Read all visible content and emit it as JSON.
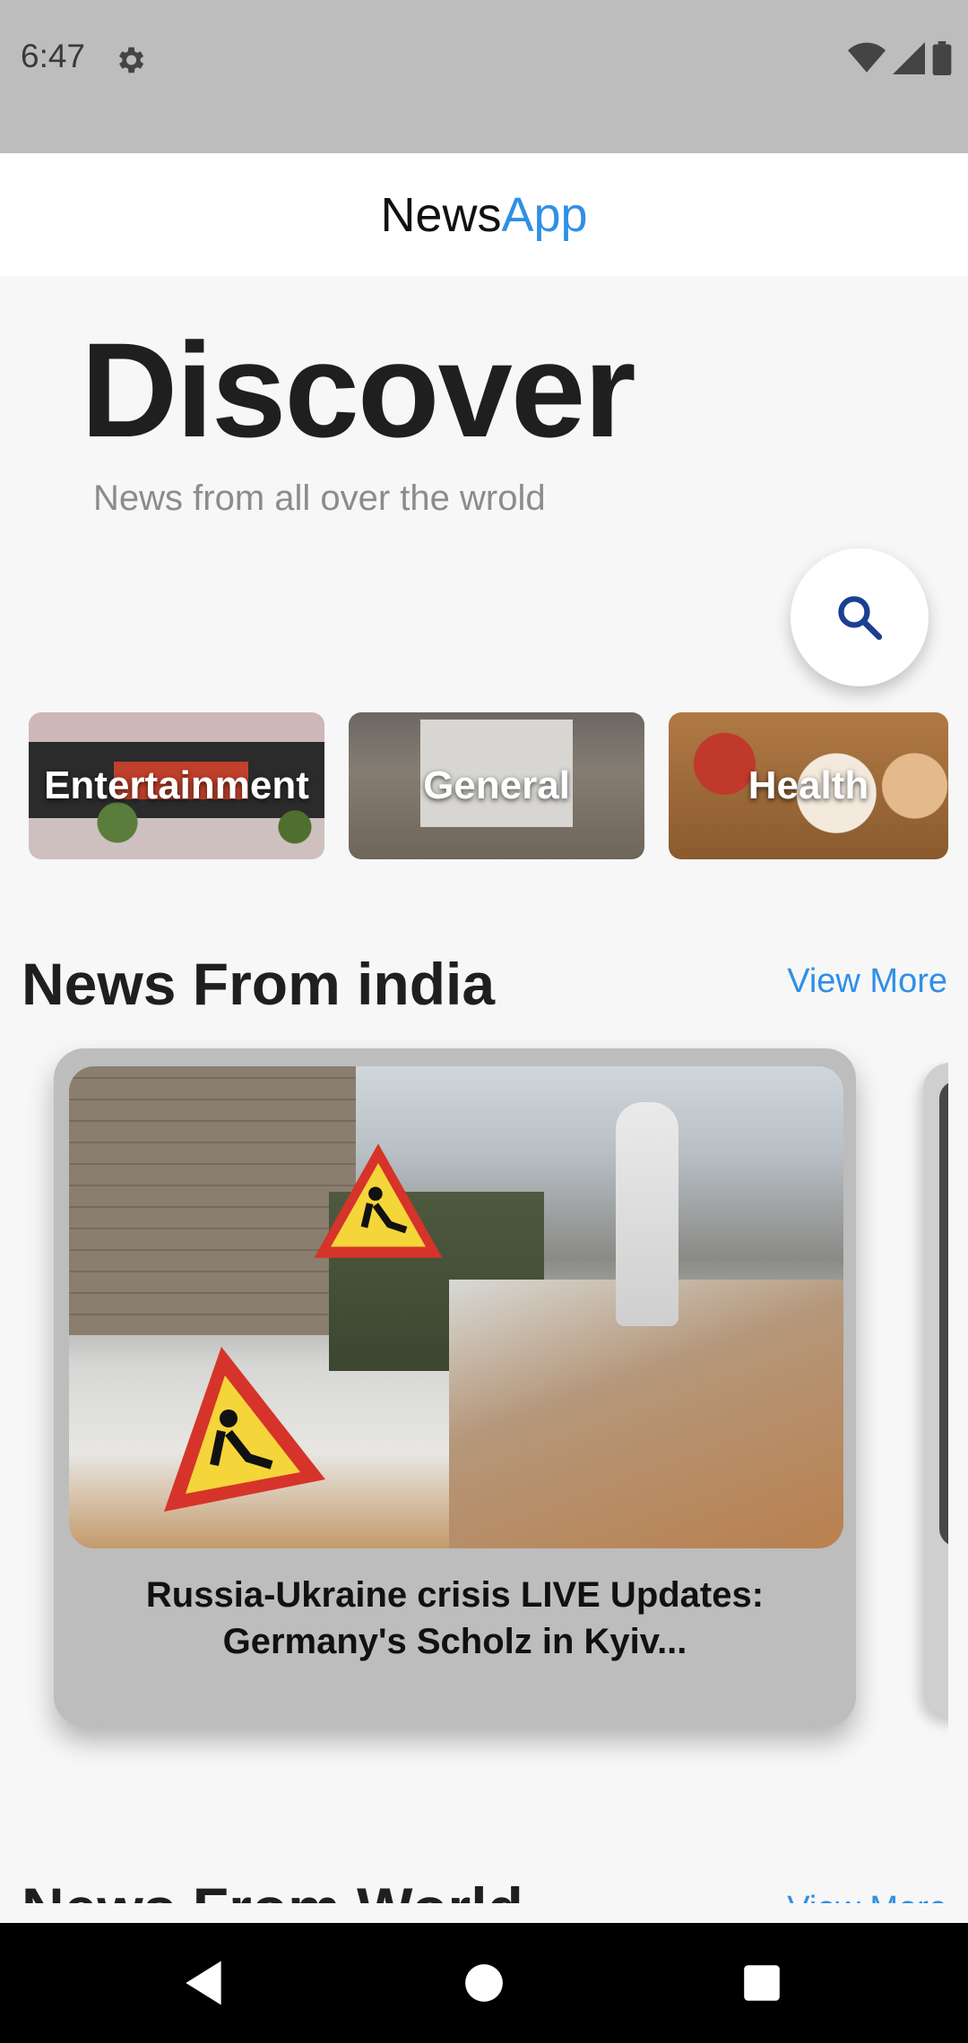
{
  "status_bar": {
    "time": "6:47",
    "icons": [
      "settings-icon",
      "wifi-icon",
      "signal-icon",
      "battery-icon"
    ]
  },
  "app_bar": {
    "title_part1": "News",
    "title_part2": "App",
    "accent_color": "#2f8fe6"
  },
  "hero": {
    "title": "Discover",
    "subtitle": "News from all over the wrold"
  },
  "search": {
    "icon": "search-icon"
  },
  "categories": [
    {
      "label": "Entertainment"
    },
    {
      "label": "General"
    },
    {
      "label": "Health"
    }
  ],
  "section_india": {
    "title": "News From india",
    "view_more": "View More"
  },
  "news_card": {
    "headline": "Russia-Ukraine crisis LIVE Updates: Germany's Scholz in Kyiv..."
  },
  "section_world": {
    "title": "News From World",
    "view_more": "View More"
  },
  "nav_bar": {
    "buttons": [
      "back-icon",
      "home-icon",
      "recents-icon"
    ]
  }
}
